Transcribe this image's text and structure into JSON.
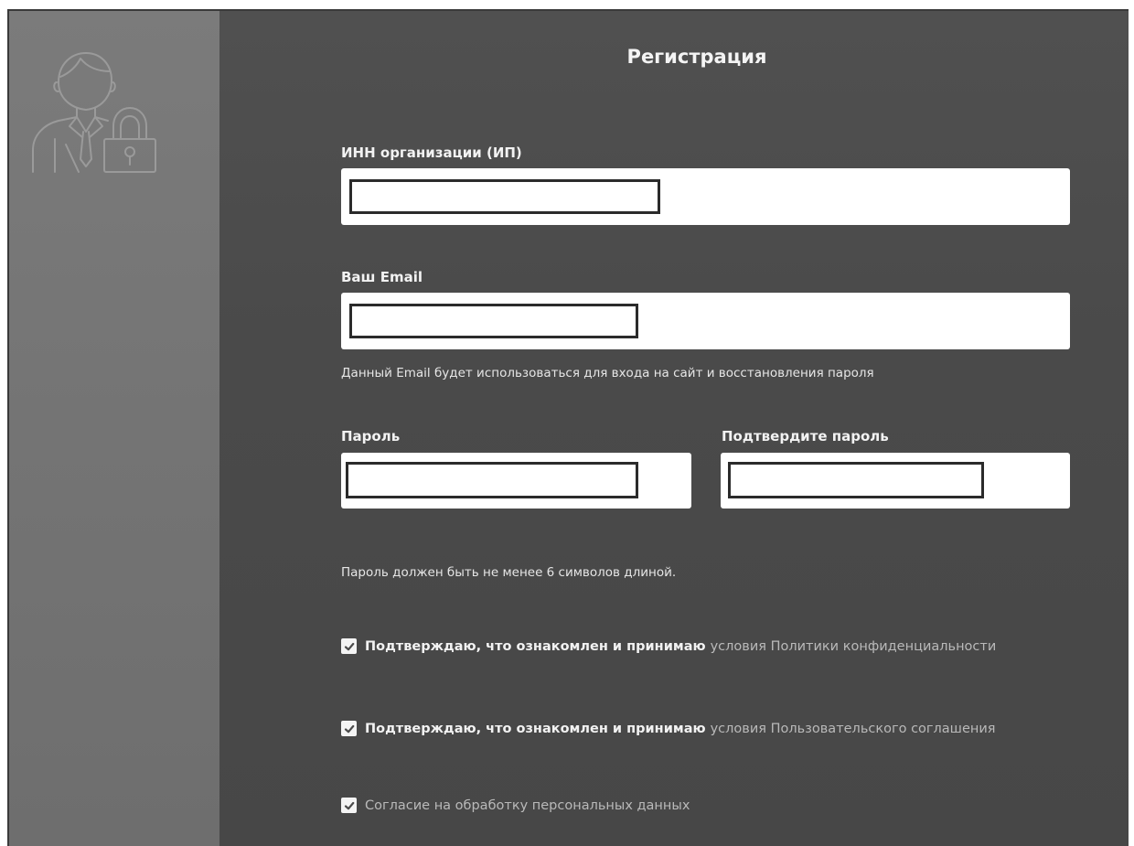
{
  "form": {
    "title": "Регистрация",
    "inn": {
      "label": "ИНН организации (ИП)",
      "value": ""
    },
    "email": {
      "label": "Ваш Email",
      "value": "",
      "hint": "Данный Email будет использоваться для входа на сайт и восстановления пароля"
    },
    "password": {
      "label": "Пароль",
      "value": ""
    },
    "confirm_password": {
      "label": "Подтвердите пароль",
      "value": ""
    },
    "password_hint": "Пароль должен быть не менее 6 символов длиной."
  },
  "consents": [
    {
      "checked": true,
      "text": "Подтверждаю, что ознакомлен и принимаю",
      "link": "условия Политики конфиденциальности"
    },
    {
      "checked": true,
      "text": "Подтверждаю, что ознакомлен и принимаю",
      "link": "условия Пользовательского соглашения"
    },
    {
      "checked": true,
      "text": "",
      "link": "Согласие на обработку персональных данных"
    }
  ],
  "icons": {
    "avatar": "user-lock-icon",
    "checkbox": "check-icon"
  },
  "colors": {
    "sidebar_bg": "#747474",
    "main_bg": "#4b4b4b",
    "input_bg": "#ffffff",
    "link_text": "#b9b9b9"
  }
}
